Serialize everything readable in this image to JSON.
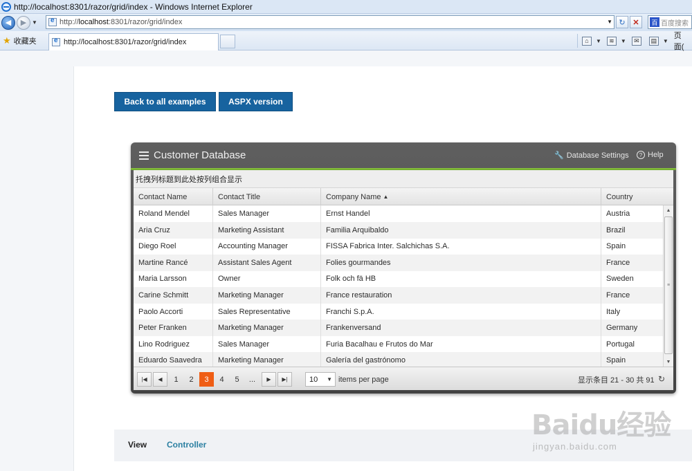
{
  "browser": {
    "window_title": "http://localhost:8301/razor/grid/index - Windows Internet Explorer",
    "address_url_prefix": "http://",
    "address_url_host": "localhost",
    "address_url_rest": ":8301/razor/grid/index",
    "search_placeholder": "百度搜索",
    "favorites_label": "收藏夹",
    "tab_title": "http://localhost:8301/razor/grid/index",
    "page_menu_label": "页面("
  },
  "page": {
    "back_button": "Back to all examples",
    "aspx_button": "ASPX version",
    "bottom_tabs": [
      "View",
      "Controller"
    ]
  },
  "grid": {
    "title": "Customer Database",
    "settings_label": "Database Settings",
    "help_label": "Help",
    "group_hint": "托拽列标题到此处按列组合显示",
    "columns": [
      "Contact Name",
      "Contact Title",
      "Company Name",
      "Country"
    ],
    "sorted_column": "Company Name",
    "rows": [
      [
        "Roland Mendel",
        "Sales Manager",
        "Ernst Handel",
        "Austria"
      ],
      [
        "Aria Cruz",
        "Marketing Assistant",
        "Familia Arquibaldo",
        "Brazil"
      ],
      [
        "Diego Roel",
        "Accounting Manager",
        "FISSA Fabrica Inter. Salchichas S.A.",
        "Spain"
      ],
      [
        "Martine Rancé",
        "Assistant Sales Agent",
        "Folies gourmandes",
        "France"
      ],
      [
        "Maria Larsson",
        "Owner",
        "Folk och fä HB",
        "Sweden"
      ],
      [
        "Carine Schmitt",
        "Marketing Manager",
        "France restauration",
        "France"
      ],
      [
        "Paolo Accorti",
        "Sales Representative",
        "Franchi S.p.A.",
        "Italy"
      ],
      [
        "Peter Franken",
        "Marketing Manager",
        "Frankenversand",
        "Germany"
      ],
      [
        "Lino Rodriguez",
        "Sales Manager",
        "Furia Bacalhau e Frutos do Mar",
        "Portugal"
      ],
      [
        "Eduardo Saavedra",
        "Marketing Manager",
        "Galería del gastrónomo",
        "Spain"
      ]
    ],
    "pager": {
      "pages": [
        "1",
        "2",
        "3",
        "4",
        "5",
        "..."
      ],
      "current_page": "3",
      "page_size": "10",
      "page_size_label": "items per page",
      "info": "显示条目 21 - 30 共 91"
    }
  },
  "watermark": {
    "main": "Baidu经验",
    "sub": "jingyan.baidu.com"
  },
  "colors": {
    "accent_blue": "#17639f",
    "grid_header": "#4f4f4f",
    "grid_accent_green": "#8cc63f",
    "active_page": "#ef5d14",
    "link_teal": "#2a7fa1"
  }
}
